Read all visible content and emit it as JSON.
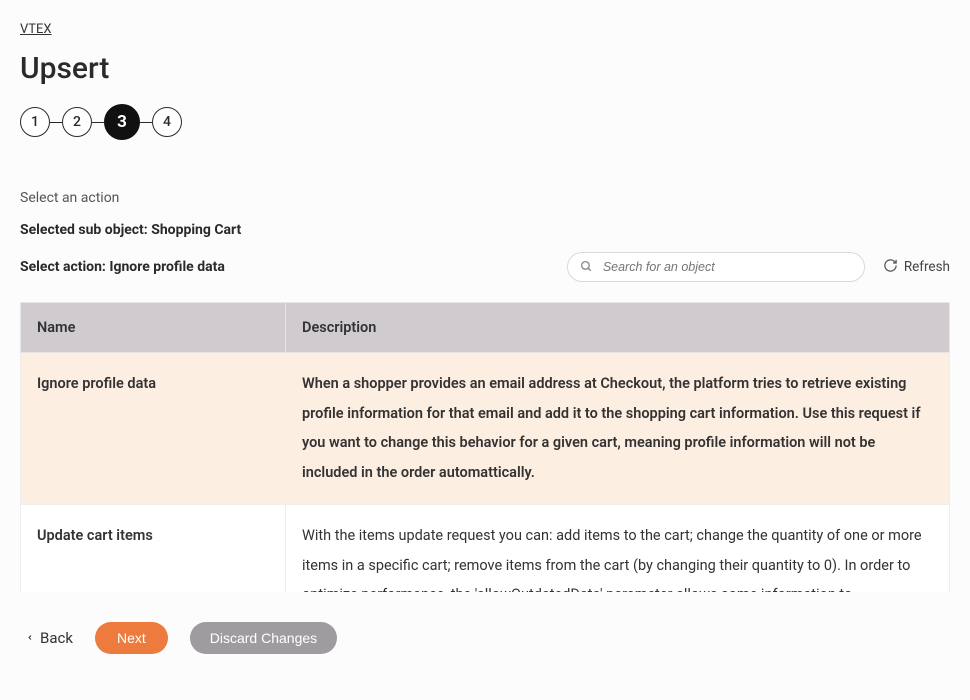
{
  "breadcrumb": "VTEX",
  "title": "Upsert",
  "stepper": {
    "s1": "1",
    "s2": "2",
    "s3": "3",
    "s4": "4"
  },
  "section_label": "Select an action",
  "sub_object_line": "Selected sub object: Shopping Cart",
  "select_action_line": "Select action: Ignore profile data",
  "search": {
    "placeholder": "Search for an object"
  },
  "refresh_label": "Refresh",
  "table": {
    "headers": {
      "name": "Name",
      "description": "Description"
    },
    "rows": {
      "r0": {
        "name": "Ignore profile data",
        "description": "When a shopper provides an email address at Checkout, the platform tries to retrieve existing profile information for that email and add it to the shopping cart information. Use this request if you want to change this behavior for a given cart, meaning profile information will not be included in the order automattically."
      },
      "r1": {
        "name": "Update cart items",
        "description": "With the items update request you can: add items to the cart; change the quantity of one or more items in a specific cart; remove items from the cart (by changing their quantity to 0). In order to optimize performance, the 'allowOutdatedData' parameter allows some information to"
      }
    }
  },
  "footer": {
    "back": "Back",
    "next": "Next",
    "discard": "Discard Changes"
  }
}
